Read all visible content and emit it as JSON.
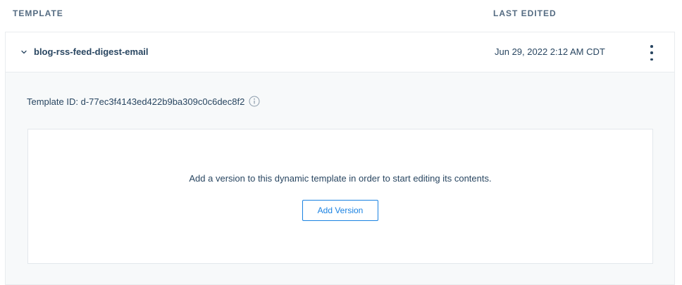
{
  "table_header": {
    "template_label": "TEMPLATE",
    "last_edited_label": "LAST EDITED"
  },
  "template": {
    "name": "blog-rss-feed-digest-email",
    "last_edited": "Jun 29, 2022 2:12 AM CDT",
    "id_label": "Template ID: d-77ec3f4143ed422b9ba309c0c6dec8f2",
    "expanded": true
  },
  "empty_state": {
    "message": "Add a version to this dynamic template in order to start editing its contents.",
    "button_label": "Add Version"
  },
  "colors": {
    "text": "#294661",
    "header_text": "#546b81",
    "accent": "#1a82e2",
    "panel_bg": "#f7f9fa",
    "border": "#e9ecef"
  },
  "icons": {
    "expand": "chevron-down-icon",
    "menu": "kebab-menu-icon",
    "info": "info-icon"
  }
}
